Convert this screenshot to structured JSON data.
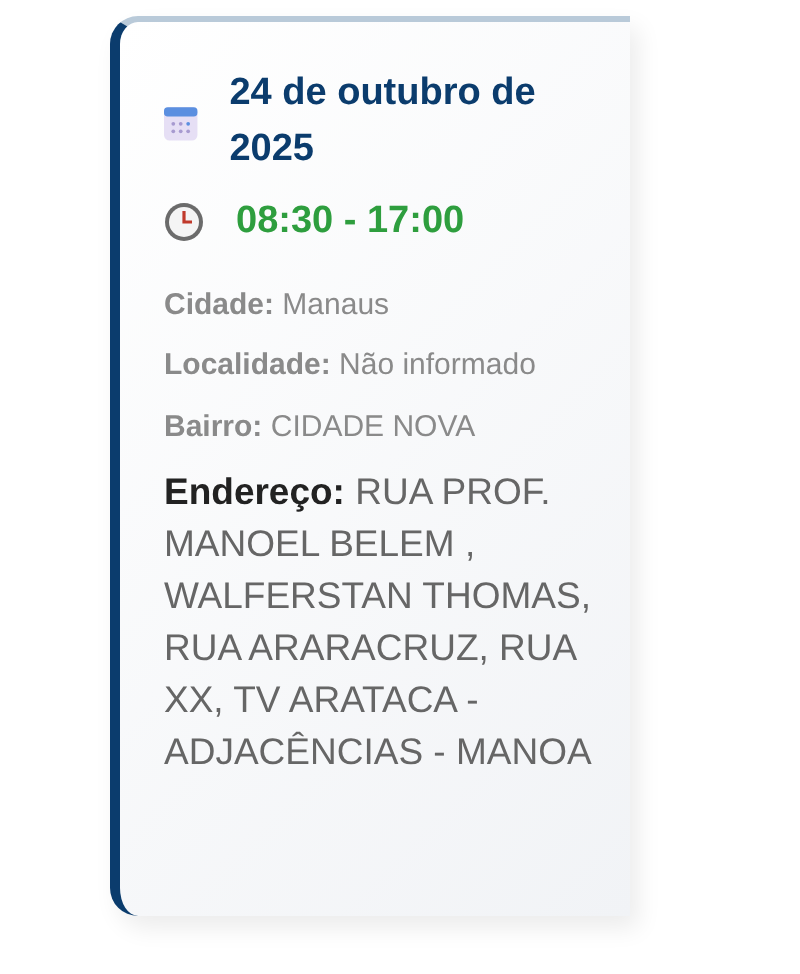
{
  "event": {
    "date": "24 de outubro de 2025",
    "time": "08:30 - 17:00",
    "details": [
      "**Cidade:** Manaus",
      "**Localidade:** Não informado",
      "**Bairro:** CIDADE NOVA"
    ],
    "address": "**Endereço:**  RUA PROF. MANOEL BELEM , WALFERSTAN THOMAS, RUA ARARACRUZ, RUA XX, TV ARATACA - ADJACÊNCIAS - MANOA"
  }
}
